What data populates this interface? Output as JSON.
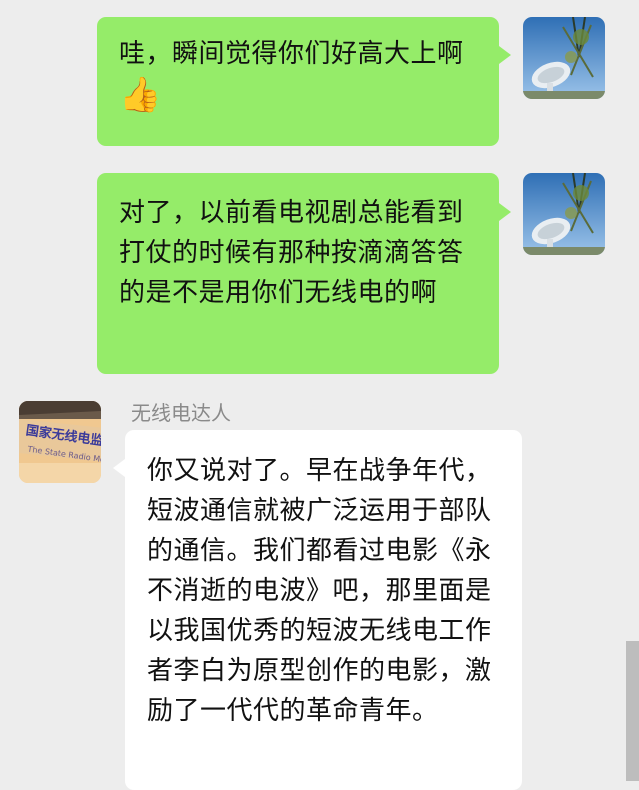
{
  "messages": [
    {
      "side": "right",
      "text": "哇，瞬间觉得你们好高大上啊",
      "emoji": "👍",
      "avatar": "satellite-dish-avatar"
    },
    {
      "side": "right",
      "text": "对了，以前看电视剧总能看到打仗的时候有那种按滴滴答答的是不是用你们无线电的啊",
      "avatar": "satellite-dish-avatar"
    },
    {
      "side": "left",
      "sender": "无线电达人",
      "text": "你又说对了。早在战争年代，短波通信就被广泛运用于部队的通信。我们都看过电影《永不消逝的电波》吧，那里面是以我国优秀的短波无线电工作者李白为原型创作的电影，激励了一代代的革命青年。",
      "avatar": "radio-station-sign-avatar",
      "avatar_text": "国家无线电监"
    }
  ],
  "colors": {
    "me_bubble": "#95ec69",
    "other_bubble": "#ffffff",
    "background": "#ededed"
  }
}
